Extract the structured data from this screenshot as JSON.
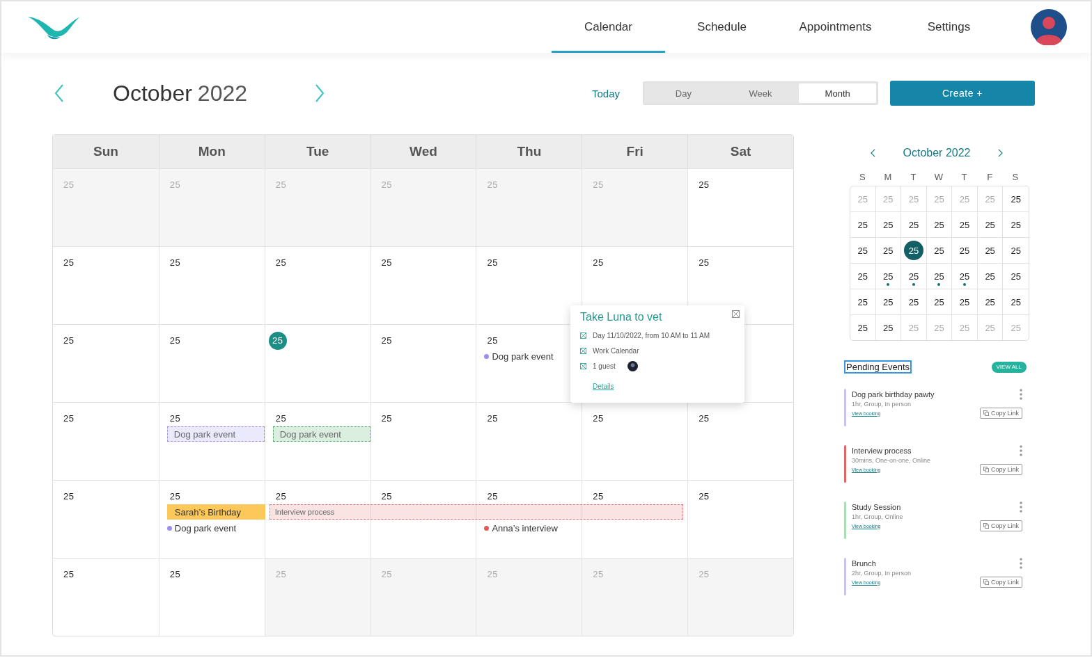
{
  "nav": {
    "tabs": [
      {
        "label": "Calendar",
        "selected": true
      },
      {
        "label": "Schedule",
        "selected": false
      },
      {
        "label": "Appointments",
        "selected": false
      },
      {
        "label": "Settings",
        "selected": false
      }
    ]
  },
  "toolbar": {
    "month": "October",
    "year": "2022",
    "today": "Today",
    "views": [
      {
        "label": "Day",
        "selected": false
      },
      {
        "label": "Week",
        "selected": false
      },
      {
        "label": "Month",
        "selected": true
      }
    ],
    "create": "Create +"
  },
  "calendar": {
    "weekdays": [
      "Sun",
      "Mon",
      "Tue",
      "Wed",
      "Thu",
      "Fri",
      "Sat"
    ],
    "weeks": [
      {
        "days": [
          {
            "number": "25",
            "muted": true,
            "today": false
          },
          {
            "number": "25",
            "muted": true,
            "today": false
          },
          {
            "number": "25",
            "muted": true,
            "today": false
          },
          {
            "number": "25",
            "muted": true,
            "today": false
          },
          {
            "number": "25",
            "muted": true,
            "today": false
          },
          {
            "number": "25",
            "muted": true,
            "today": false
          },
          {
            "number": "25",
            "muted": false,
            "today": false
          }
        ]
      },
      {
        "days": [
          {
            "number": "25",
            "muted": false,
            "today": false
          },
          {
            "number": "25",
            "muted": false,
            "today": false
          },
          {
            "number": "25",
            "muted": false,
            "today": false
          },
          {
            "number": "25",
            "muted": false,
            "today": false
          },
          {
            "number": "25",
            "muted": false,
            "today": false
          },
          {
            "number": "25",
            "muted": false,
            "today": false
          },
          {
            "number": "25",
            "muted": false,
            "today": false
          }
        ]
      },
      {
        "days": [
          {
            "number": "25",
            "muted": false,
            "today": false
          },
          {
            "number": "25",
            "muted": false,
            "today": false
          },
          {
            "number": "25",
            "muted": false,
            "today": true
          },
          {
            "number": "25",
            "muted": false,
            "today": false
          },
          {
            "number": "25",
            "muted": false,
            "today": false,
            "events": [
              {
                "kind": "dot",
                "label": "Dog park event",
                "color": "#9b8ff0"
              }
            ]
          }
        ]
      },
      {
        "days": [
          {
            "number": "25",
            "muted": false,
            "today": false
          },
          {
            "number": "25",
            "muted": false,
            "today": false,
            "events": [
              {
                "kind": "dashed",
                "label": "Dog park event",
                "color": "#9b8ff0"
              }
            ]
          },
          {
            "number": "25",
            "muted": false,
            "today": false,
            "events": [
              {
                "kind": "dashed",
                "label": "Dog park event",
                "color": "#4caf6a"
              }
            ]
          },
          {
            "number": "25",
            "muted": false,
            "today": false
          },
          {
            "number": "25",
            "muted": false,
            "today": false
          },
          {
            "number": "25",
            "muted": false,
            "today": false
          },
          {
            "number": "25",
            "muted": false,
            "today": false
          }
        ]
      },
      {
        "days": [
          {
            "number": "25",
            "muted": false,
            "today": false
          },
          {
            "number": "25",
            "muted": false,
            "today": false,
            "events": [
              {
                "kind": "solid",
                "label": "Sarah’s Birthday",
                "color": "#fdc85a"
              },
              {
                "kind": "dot",
                "label": "Dog park event",
                "color": "#9b8ff0"
              }
            ]
          },
          {
            "number": "25",
            "muted": false,
            "today": false,
            "events": [
              {
                "kind": "span",
                "label": "Interview process",
                "color": "#e57373"
              }
            ]
          },
          {
            "number": "25",
            "muted": false,
            "today": false
          },
          {
            "number": "25",
            "muted": false,
            "today": false,
            "events": [
              {
                "kind": "dot",
                "label": "Anna’s interview",
                "color": "#e05a5a"
              }
            ]
          },
          {
            "number": "25",
            "muted": false,
            "today": false
          },
          {
            "number": "25",
            "muted": false,
            "today": false
          }
        ]
      },
      {
        "days": [
          {
            "number": "25",
            "muted": false,
            "today": false
          },
          {
            "number": "25",
            "muted": false,
            "today": false
          },
          {
            "number": "25",
            "muted": true,
            "today": false
          },
          {
            "number": "25",
            "muted": true,
            "today": false
          },
          {
            "number": "25",
            "muted": true,
            "today": false
          },
          {
            "number": "25",
            "muted": true,
            "today": false
          },
          {
            "number": "25",
            "muted": true,
            "today": false
          }
        ]
      }
    ]
  },
  "popup": {
    "title": "Take Luna to vet",
    "rows": [
      {
        "text": "Day 11/10/2022, from 10 AM to 11 AM",
        "kind": "text"
      },
      {
        "text": "Work Calendar",
        "kind": "text"
      },
      {
        "text": "1 guest",
        "kind": "guest"
      }
    ],
    "link": "Details"
  },
  "mini_calendar": {
    "title": "October 2022",
    "weekdays": [
      "S",
      "M",
      "T",
      "W",
      "T",
      "F",
      "S"
    ],
    "weeks": [
      [
        {
          "number": "25",
          "muted": true,
          "selected": false,
          "dot": false
        },
        {
          "number": "25",
          "muted": true,
          "selected": false,
          "dot": false
        },
        {
          "number": "25",
          "muted": true,
          "selected": false,
          "dot": false
        },
        {
          "number": "25",
          "muted": true,
          "selected": false,
          "dot": false
        },
        {
          "number": "25",
          "muted": true,
          "selected": false,
          "dot": false
        },
        {
          "number": "25",
          "muted": true,
          "selected": false,
          "dot": false
        },
        {
          "number": "25",
          "muted": false,
          "selected": false,
          "dot": false
        }
      ],
      [
        {
          "number": "25",
          "muted": false,
          "selected": false,
          "dot": false
        },
        {
          "number": "25",
          "muted": false,
          "selected": false,
          "dot": false
        },
        {
          "number": "25",
          "muted": false,
          "selected": false,
          "dot": false
        },
        {
          "number": "25",
          "muted": false,
          "selected": false,
          "dot": false
        },
        {
          "number": "25",
          "muted": false,
          "selected": false,
          "dot": false
        },
        {
          "number": "25",
          "muted": false,
          "selected": false,
          "dot": false
        },
        {
          "number": "25",
          "muted": false,
          "selected": false,
          "dot": false
        }
      ],
      [
        {
          "number": "25",
          "muted": false,
          "selected": false,
          "dot": false
        },
        {
          "number": "25",
          "muted": false,
          "selected": false,
          "dot": false
        },
        {
          "number": "25",
          "muted": false,
          "selected": true,
          "dot": false
        },
        {
          "number": "25",
          "muted": false,
          "selected": false,
          "dot": false
        },
        {
          "number": "25",
          "muted": false,
          "selected": false,
          "dot": false
        },
        {
          "number": "25",
          "muted": false,
          "selected": false,
          "dot": false
        },
        {
          "number": "25",
          "muted": false,
          "selected": false,
          "dot": false
        }
      ],
      [
        {
          "number": "25",
          "muted": false,
          "selected": false,
          "dot": false
        },
        {
          "number": "25",
          "muted": false,
          "selected": false,
          "dot": true
        },
        {
          "number": "25",
          "muted": false,
          "selected": false,
          "dot": true
        },
        {
          "number": "25",
          "muted": false,
          "selected": false,
          "dot": true
        },
        {
          "number": "25",
          "muted": false,
          "selected": false,
          "dot": true
        },
        {
          "number": "25",
          "muted": false,
          "selected": false,
          "dot": false
        },
        {
          "number": "25",
          "muted": false,
          "selected": false,
          "dot": false
        }
      ],
      [
        {
          "number": "25",
          "muted": false,
          "selected": false,
          "dot": false
        },
        {
          "number": "25",
          "muted": false,
          "selected": false,
          "dot": false
        },
        {
          "number": "25",
          "muted": false,
          "selected": false,
          "dot": false
        },
        {
          "number": "25",
          "muted": false,
          "selected": false,
          "dot": false
        },
        {
          "number": "25",
          "muted": false,
          "selected": false,
          "dot": false
        },
        {
          "number": "25",
          "muted": false,
          "selected": false,
          "dot": false
        },
        {
          "number": "25",
          "muted": false,
          "selected": false,
          "dot": false
        }
      ],
      [
        {
          "number": "25",
          "muted": false,
          "selected": false,
          "dot": false
        },
        {
          "number": "25",
          "muted": false,
          "selected": false,
          "dot": false
        },
        {
          "number": "25",
          "muted": true,
          "selected": false,
          "dot": false
        },
        {
          "number": "25",
          "muted": true,
          "selected": false,
          "dot": false
        },
        {
          "number": "25",
          "muted": true,
          "selected": false,
          "dot": false
        },
        {
          "number": "25",
          "muted": true,
          "selected": false,
          "dot": false
        },
        {
          "number": "25",
          "muted": true,
          "selected": false,
          "dot": false
        }
      ]
    ]
  },
  "pending": {
    "title": "Pending Events",
    "view_all": "VIEW ALL",
    "events": [
      {
        "title": "Dog park birthday pawty",
        "meta": "1hr, Group, In person",
        "link": "View booking",
        "button": "Copy Link",
        "color": "#c7c3f2"
      },
      {
        "title": "Interview process",
        "meta": "30mins, One-on-one, Online",
        "link": "View booking",
        "button": "Copy Link",
        "color": "#e06666"
      },
      {
        "title": "Study Session",
        "meta": "1hr, Group, Online",
        "link": "View booking",
        "button": "Copy Link",
        "color": "#a8dfb4"
      },
      {
        "title": "Brunch",
        "meta": "2hr, Group, In person",
        "link": "View booking",
        "button": "Copy Link",
        "color": "#c7c3f2"
      }
    ]
  }
}
